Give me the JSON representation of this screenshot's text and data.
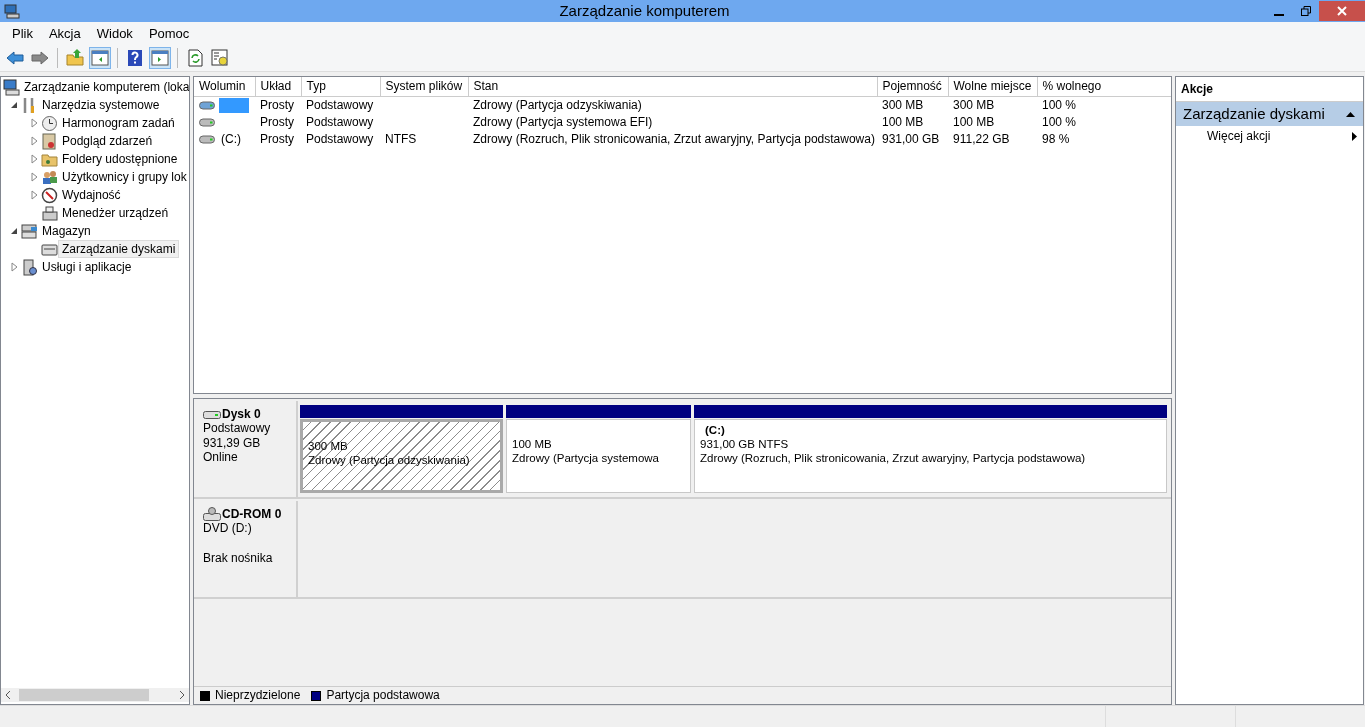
{
  "window": {
    "title": "Zarządzanie komputerem"
  },
  "menu": [
    "Plik",
    "Akcja",
    "Widok",
    "Pomoc"
  ],
  "toolbar": [
    {
      "kind": "back",
      "pressed": false
    },
    {
      "kind": "forward",
      "pressed": false
    },
    {
      "kind": "sep"
    },
    {
      "kind": "up",
      "pressed": false
    },
    {
      "kind": "tree",
      "pressed": true
    },
    {
      "kind": "sep"
    },
    {
      "kind": "help",
      "pressed": false
    },
    {
      "kind": "pane",
      "pressed": true
    },
    {
      "kind": "sep"
    },
    {
      "kind": "refresh",
      "pressed": false
    },
    {
      "kind": "props",
      "pressed": false
    }
  ],
  "tree": [
    {
      "label": "Zarządzanie komputerem (loka",
      "kind": "computer",
      "selected": false,
      "children": [
        {
          "label": "Narzędzia systemowe",
          "kind": "tools",
          "expanded": true,
          "selected": false,
          "children": [
            {
              "label": "Harmonogram zadań",
              "kind": "clock",
              "expanded": false,
              "selected": false
            },
            {
              "label": "Podgląd zdarzeń",
              "kind": "log",
              "expanded": false,
              "selected": false
            },
            {
              "label": "Foldery udostępnione",
              "kind": "folder",
              "expanded": false,
              "selected": false
            },
            {
              "label": "Użytkownicy i grupy lok",
              "kind": "users",
              "expanded": false,
              "selected": false
            },
            {
              "label": "Wydajność",
              "kind": "perf",
              "expanded": false,
              "selected": false
            },
            {
              "label": "Menedżer urządzeń",
              "kind": "device",
              "selected": false
            }
          ]
        },
        {
          "label": "Magazyn",
          "kind": "storage",
          "expanded": true,
          "selected": false,
          "children": [
            {
              "label": "Zarządzanie dyskami",
              "kind": "disk",
              "selected": true
            }
          ]
        },
        {
          "label": "Usługi i aplikacje",
          "kind": "services",
          "expanded": false,
          "selected": false
        }
      ]
    }
  ],
  "table": {
    "columns": [
      "Wolumin",
      "Układ",
      "Typ",
      "System plików",
      "Stan",
      "Pojemność",
      "Wolne miejsce",
      "% wolnego"
    ],
    "rows": [
      {
        "selected": true,
        "cells": [
          "",
          "Prosty",
          "Podstawowy",
          "",
          "Zdrowy (Partycja odzyskiwania)",
          "300 MB",
          "300 MB",
          "100 %"
        ]
      },
      {
        "selected": false,
        "cells": [
          "",
          "Prosty",
          "Podstawowy",
          "",
          "Zdrowy (Partycja systemowa EFI)",
          "100 MB",
          "100 MB",
          "100 %"
        ]
      },
      {
        "selected": false,
        "cells": [
          "(C:)",
          "Prosty",
          "Podstawowy",
          "NTFS",
          "Zdrowy (Rozruch, Plik stronicowania, Zrzut awaryjny, Partycja podstawowa)",
          "931,00 GB",
          "911,22 GB",
          "98 %"
        ]
      }
    ]
  },
  "disks": [
    {
      "kind": "disk",
      "name": "Dysk 0",
      "lines": [
        "Podstawowy",
        "931,39 GB",
        "Online"
      ],
      "partitions": [
        {
          "selected": true,
          "color": "#000080",
          "lines": [
            "300 MB",
            "Zdrowy (Partycja odzyskiwania)"
          ]
        },
        {
          "selected": false,
          "color": "#000080",
          "lines": [
            "100 MB",
            "Zdrowy (Partycja systemowa"
          ]
        },
        {
          "selected": false,
          "color": "#000080",
          "title": "(C:)",
          "lines": [
            "931,00 GB NTFS",
            "Zdrowy (Rozruch, Plik stronicowania, Zrzut awaryjny, Partycja podstawowa)"
          ]
        }
      ]
    },
    {
      "kind": "cdrom",
      "name": "CD-ROM 0",
      "lines": [
        "DVD (D:)"
      ],
      "status": "Brak nośnika"
    }
  ],
  "legend": [
    {
      "label": "Nieprzydzielone",
      "color": "#000000"
    },
    {
      "label": "Partycja podstawowa",
      "color": "#000080"
    }
  ],
  "actions": {
    "title": "Akcje",
    "section": {
      "label": "Zarządzanie dyskami",
      "expanded": true
    },
    "items": [
      "Więcej akcji"
    ]
  }
}
